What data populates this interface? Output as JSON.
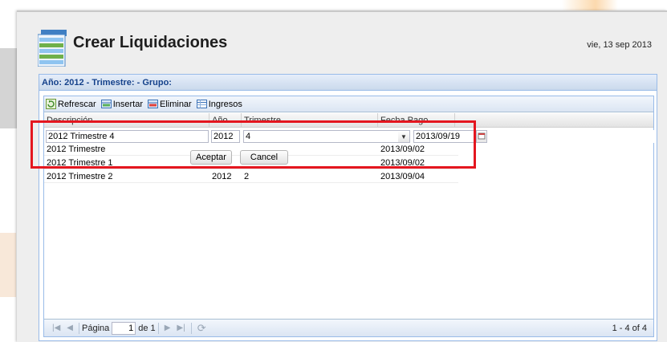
{
  "header": {
    "title": "Crear Liquidaciones",
    "date": "vie, 13 sep 2013"
  },
  "panel": {
    "title": "Año: 2012 - Trimestre: - Grupo:"
  },
  "toolbar": {
    "refresh_label": "Refrescar",
    "insert_label": "Insertar",
    "delete_label": "Eliminar",
    "income_label": "Ingresos"
  },
  "columns": [
    "Descripción",
    "Año",
    "Trimestre",
    "Fecha Pago"
  ],
  "editor": {
    "descripcion": "2012 Trimestre 4",
    "anio": "2012",
    "trimestre": "4",
    "fecha_pago": "2013/09/19",
    "accept_label": "Aceptar",
    "cancel_label": "Cancel"
  },
  "rows": [
    {
      "descripcion": "2012 Trimestre",
      "anio": "",
      "trimestre": "",
      "fecha_pago": "2013/09/02"
    },
    {
      "descripcion": "2012 Trimestre 1",
      "anio": "",
      "trimestre": "",
      "fecha_pago": "2013/09/02"
    },
    {
      "descripcion": "2012 Trimestre 2",
      "anio": "2012",
      "trimestre": "2",
      "fecha_pago": "2013/09/04"
    }
  ],
  "pager": {
    "page_label": "Página",
    "page_value": "1",
    "of_label": "de 1",
    "summary": "1 - 4 of 4"
  },
  "colors": {
    "highlight_outline": "#e4161f",
    "panel_title": "#15428b"
  }
}
